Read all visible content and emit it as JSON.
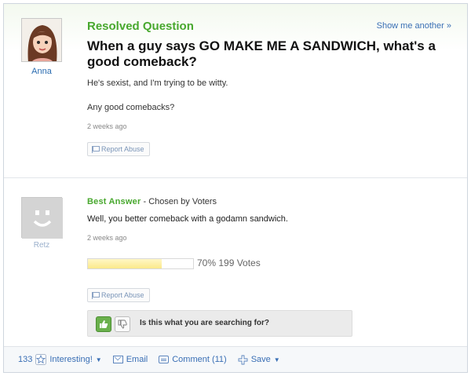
{
  "question": {
    "status": "Resolved Question",
    "show_another": "Show me another »",
    "asker_name": "Anna",
    "title": "When a guy says GO MAKE ME A SANDWICH, what's a good comeback?",
    "body_line1": "He's sexist, and I'm trying to be witty.",
    "body_line2": "Any good comebacks?",
    "time": "2 weeks ago",
    "report_label": "Report Abuse"
  },
  "answer": {
    "label": "Best Answer",
    "chosen_by": " - Chosen by Voters",
    "answerer_name": "Retz",
    "body": "Well, you better comeback with a godamn sandwich.",
    "time": "2 weeks ago",
    "vote_percent": 70,
    "vote_text": "70% 199 Votes",
    "report_label": "Report Abuse"
  },
  "search_prompt": {
    "question": "Is this what you are searching for?"
  },
  "footer": {
    "count": "133",
    "interesting": "Interesting!",
    "email": "Email",
    "comment": "Comment (11)",
    "save": "Save"
  },
  "colors": {
    "green": "#48a82e",
    "link_blue": "#3a6fb5"
  }
}
